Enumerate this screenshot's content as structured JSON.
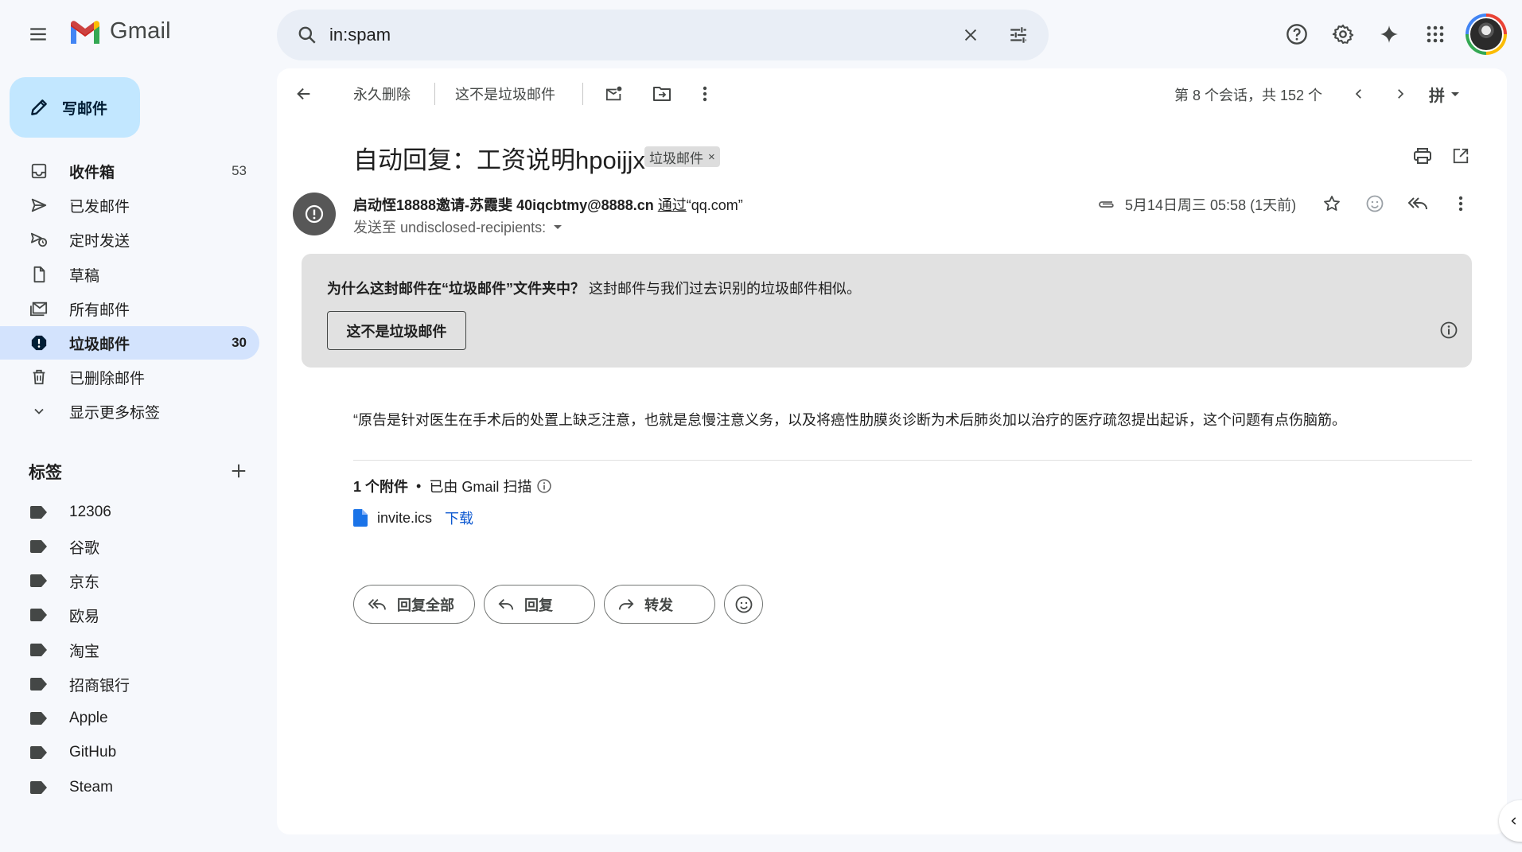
{
  "header": {
    "app_name": "Gmail",
    "search_value": "in:spam"
  },
  "sidebar": {
    "compose_label": "写邮件",
    "items": [
      {
        "label": "收件箱",
        "count": "53",
        "icon": "inbox-icon"
      },
      {
        "label": "已发邮件",
        "count": "",
        "icon": "send-icon"
      },
      {
        "label": "定时发送",
        "count": "",
        "icon": "scheduled-icon"
      },
      {
        "label": "草稿",
        "count": "",
        "icon": "draft-icon"
      },
      {
        "label": "所有邮件",
        "count": "",
        "icon": "all-mail-icon"
      },
      {
        "label": "垃圾邮件",
        "count": "30",
        "icon": "spam-icon"
      },
      {
        "label": "已删除邮件",
        "count": "",
        "icon": "trash-icon"
      },
      {
        "label": "显示更多标签",
        "count": "",
        "icon": "chevron-down-icon"
      }
    ],
    "labels_heading": "标签",
    "labels": [
      "12306",
      "谷歌",
      "京东",
      "欧易",
      "淘宝",
      "招商银行",
      "Apple",
      "GitHub",
      "Steam"
    ]
  },
  "toolbar": {
    "delete_forever": "永久删除",
    "not_spam": "这不是垃圾邮件",
    "pager": "第 8 个会话，共 152 个",
    "input_tool": "拼"
  },
  "message": {
    "subject": "自动回复：工资说明hpoijjx",
    "spam_chip": "垃圾邮件",
    "spam_chip_close": "×",
    "sender_name": "启动恎18888邀请-苏霞斐",
    "sender_email": "40iqcbtmy@8888.cn",
    "via_label": "通过",
    "via_domain": "“qq.com”",
    "recipients": "发送至 undisclosed-recipients:",
    "date": "5月14日周三 05:58 (1天前)",
    "spam_banner": {
      "reason_strong": "为什么这封邮件在“垃圾邮件”文件夹中？",
      "reason_text": "这封邮件与我们过去识别的垃圾邮件相似。",
      "button": "这不是垃圾邮件"
    },
    "body": "“原告是针对医生在手术后的处置上缺乏注意，也就是怠慢注意义务，以及将癌性肋膜炎诊断为术后肺炎加以治疗的医疗疏忽提出起诉，这个问题有点伤脑筋。",
    "attachments": {
      "count_label": "1 个附件",
      "separator": "•",
      "scan_label": "已由 Gmail 扫描",
      "file_name": "invite.ics",
      "download_label": "下载"
    },
    "actions": {
      "reply_all": "回复全部",
      "reply": "回复",
      "forward": "转发"
    }
  },
  "colors": {
    "background": "#f6f8fc",
    "compose": "#c2e7ff",
    "active_nav": "#d3e3fd",
    "banner": "#e1e1e1",
    "link": "#0b57d0"
  }
}
